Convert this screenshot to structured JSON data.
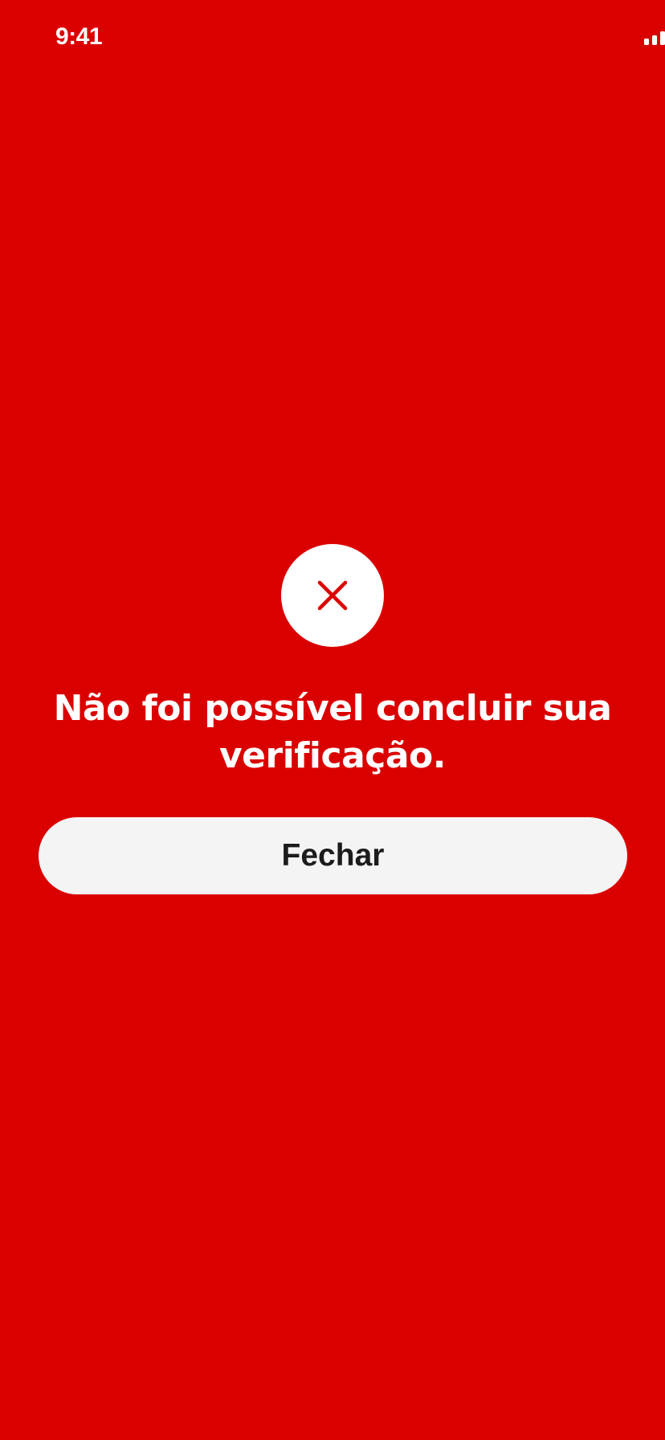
{
  "status_bar": {
    "time": "9:41",
    "icons": [
      "cellular-signal-icon",
      "wifi-icon",
      "battery-icon"
    ]
  },
  "error": {
    "icon": "close-x-icon",
    "message": "Não foi possível concluir sua verificação."
  },
  "actions": {
    "close_label": "Fechar"
  },
  "colors": {
    "background": "#DB0000",
    "icon_circle": "#FFFFFF",
    "icon_stroke": "#DB0000",
    "text": "#FFFFFF",
    "button_background": "#F4F4F4",
    "button_text": "#1C1C1C"
  }
}
